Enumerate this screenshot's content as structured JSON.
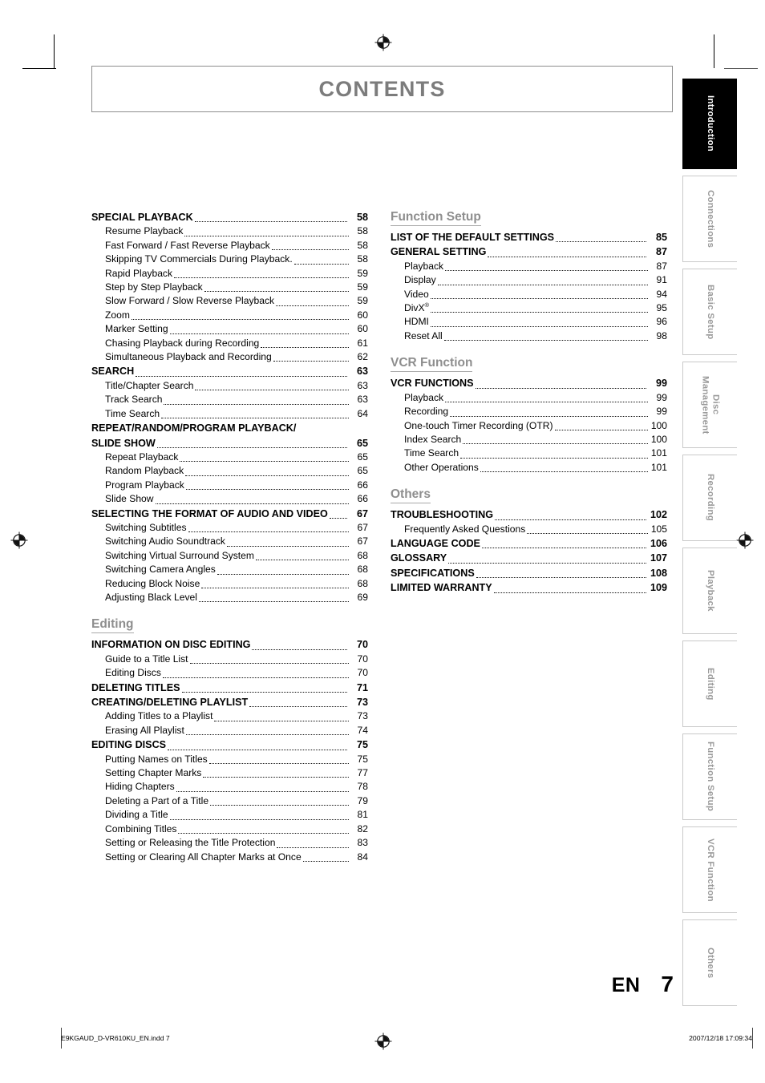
{
  "header": {
    "title": "CONTENTS"
  },
  "page_number": {
    "language": "EN",
    "number": "7"
  },
  "footer": {
    "file": "E9KGAUD_D-VR610KU_EN.indd   7",
    "timestamp": "2007/12/18   17:09:34"
  },
  "tabs": [
    {
      "label": "Introduction",
      "active": true
    },
    {
      "label": "Connections",
      "active": false
    },
    {
      "label": "Basic Setup",
      "active": false
    },
    {
      "label": "Disc\nManagement",
      "active": false
    },
    {
      "label": "Recording",
      "active": false
    },
    {
      "label": "Playback",
      "active": false
    },
    {
      "label": "Editing",
      "active": false
    },
    {
      "label": "Function Setup",
      "active": false
    },
    {
      "label": "VCR Function",
      "active": false
    },
    {
      "label": "Others",
      "active": false
    }
  ],
  "left_column": [
    {
      "heading": null,
      "entries": [
        {
          "level": 1,
          "label": "SPECIAL PLAYBACK",
          "page": "58"
        },
        {
          "level": 2,
          "label": "Resume Playback",
          "page": "58"
        },
        {
          "level": 2,
          "label": "Fast Forward / Fast Reverse Playback",
          "page": "58"
        },
        {
          "level": 2,
          "label": "Skipping TV Commercials During Playback.",
          "page": "58"
        },
        {
          "level": 2,
          "label": "Rapid Playback",
          "page": "59"
        },
        {
          "level": 2,
          "label": "Step by Step Playback",
          "page": "59"
        },
        {
          "level": 2,
          "label": "Slow Forward / Slow Reverse Playback",
          "page": "59"
        },
        {
          "level": 2,
          "label": "Zoom",
          "page": "60"
        },
        {
          "level": 2,
          "label": "Marker Setting",
          "page": "60"
        },
        {
          "level": 2,
          "label": "Chasing Playback during Recording",
          "page": "61"
        },
        {
          "level": 2,
          "label": "Simultaneous Playback and Recording",
          "page": "62"
        },
        {
          "level": 1,
          "label": "SEARCH",
          "page": "63"
        },
        {
          "level": 2,
          "label": "Title/Chapter Search",
          "page": "63"
        },
        {
          "level": 2,
          "label": "Track Search",
          "page": "63"
        },
        {
          "level": 2,
          "label": "Time Search",
          "page": "64"
        },
        {
          "level": 1,
          "label": "REPEAT/RANDOM/PROGRAM PLAYBACK/",
          "page": "",
          "nodots": true
        },
        {
          "level": 1,
          "label": "SLIDE SHOW",
          "page": "65"
        },
        {
          "level": 2,
          "label": "Repeat Playback",
          "page": "65"
        },
        {
          "level": 2,
          "label": "Random Playback",
          "page": "65"
        },
        {
          "level": 2,
          "label": "Program Playback",
          "page": "66"
        },
        {
          "level": 2,
          "label": "Slide Show",
          "page": "66"
        },
        {
          "level": 1,
          "label": "SELECTING THE FORMAT OF AUDIO AND VIDEO",
          "page": "67"
        },
        {
          "level": 2,
          "label": "Switching Subtitles",
          "page": "67"
        },
        {
          "level": 2,
          "label": "Switching Audio Soundtrack",
          "page": "67"
        },
        {
          "level": 2,
          "label": "Switching Virtual Surround System",
          "page": "68"
        },
        {
          "level": 2,
          "label": "Switching Camera Angles",
          "page": "68"
        },
        {
          "level": 2,
          "label": "Reducing Block Noise",
          "page": "68"
        },
        {
          "level": 2,
          "label": "Adjusting Black Level",
          "page": "69"
        }
      ]
    },
    {
      "heading": "Editing",
      "entries": [
        {
          "level": 1,
          "label": "INFORMATION ON DISC EDITING",
          "page": "70"
        },
        {
          "level": 2,
          "label": "Guide to a Title List",
          "page": "70"
        },
        {
          "level": 2,
          "label": "Editing Discs",
          "page": "70"
        },
        {
          "level": 1,
          "label": "DELETING TITLES",
          "page": "71"
        },
        {
          "level": 1,
          "label": "CREATING/DELETING PLAYLIST",
          "page": "73"
        },
        {
          "level": 2,
          "label": "Adding Titles to a Playlist",
          "page": "73"
        },
        {
          "level": 2,
          "label": "Erasing All Playlist",
          "page": "74"
        },
        {
          "level": 1,
          "label": "EDITING DISCS",
          "page": "75"
        },
        {
          "level": 2,
          "label": "Putting Names on Titles",
          "page": "75"
        },
        {
          "level": 2,
          "label": "Setting Chapter Marks",
          "page": "77"
        },
        {
          "level": 2,
          "label": "Hiding Chapters",
          "page": "78"
        },
        {
          "level": 2,
          "label": "Deleting a Part of a Title",
          "page": "79"
        },
        {
          "level": 2,
          "label": "Dividing a Title",
          "page": "81"
        },
        {
          "level": 2,
          "label": "Combining Titles",
          "page": "82"
        },
        {
          "level": 2,
          "label": "Setting or Releasing the Title Protection",
          "page": "83"
        },
        {
          "level": 2,
          "label": "Setting or Clearing All Chapter Marks at Once",
          "page": "84"
        }
      ]
    }
  ],
  "right_column": [
    {
      "heading": "Function Setup",
      "entries": [
        {
          "level": 1,
          "label": "LIST OF THE DEFAULT SETTINGS",
          "page": "85"
        },
        {
          "level": 1,
          "label": "GENERAL SETTING",
          "page": "87"
        },
        {
          "level": 2,
          "label": "Playback",
          "page": "87"
        },
        {
          "level": 2,
          "label": "Display",
          "page": "91"
        },
        {
          "level": 2,
          "label": "Video",
          "page": "94"
        },
        {
          "level": 2,
          "label": "DivX®",
          "page": "95"
        },
        {
          "level": 2,
          "label": "HDMI",
          "page": "96"
        },
        {
          "level": 2,
          "label": "Reset All",
          "page": "98"
        }
      ]
    },
    {
      "heading": "VCR Function",
      "entries": [
        {
          "level": 1,
          "label": "VCR FUNCTIONS",
          "page": "99"
        },
        {
          "level": 2,
          "label": "Playback",
          "page": "99"
        },
        {
          "level": 2,
          "label": "Recording",
          "page": "99"
        },
        {
          "level": 2,
          "label": "One-touch Timer Recording (OTR)",
          "page": "100"
        },
        {
          "level": 2,
          "label": "Index Search",
          "page": "100"
        },
        {
          "level": 2,
          "label": "Time Search",
          "page": "101"
        },
        {
          "level": 2,
          "label": "Other Operations",
          "page": "101"
        }
      ]
    },
    {
      "heading": "Others",
      "entries": [
        {
          "level": 1,
          "label": "TROUBLESHOOTING",
          "page": "102"
        },
        {
          "level": 2,
          "label": "Frequently Asked Questions",
          "page": "105"
        },
        {
          "level": 1,
          "label": "LANGUAGE CODE",
          "page": "106"
        },
        {
          "level": 1,
          "label": "GLOSSARY",
          "page": "107"
        },
        {
          "level": 1,
          "label": "SPECIFICATIONS",
          "page": "108"
        },
        {
          "level": 1,
          "label": "LIMITED WARRANTY",
          "page": "109"
        }
      ]
    }
  ]
}
